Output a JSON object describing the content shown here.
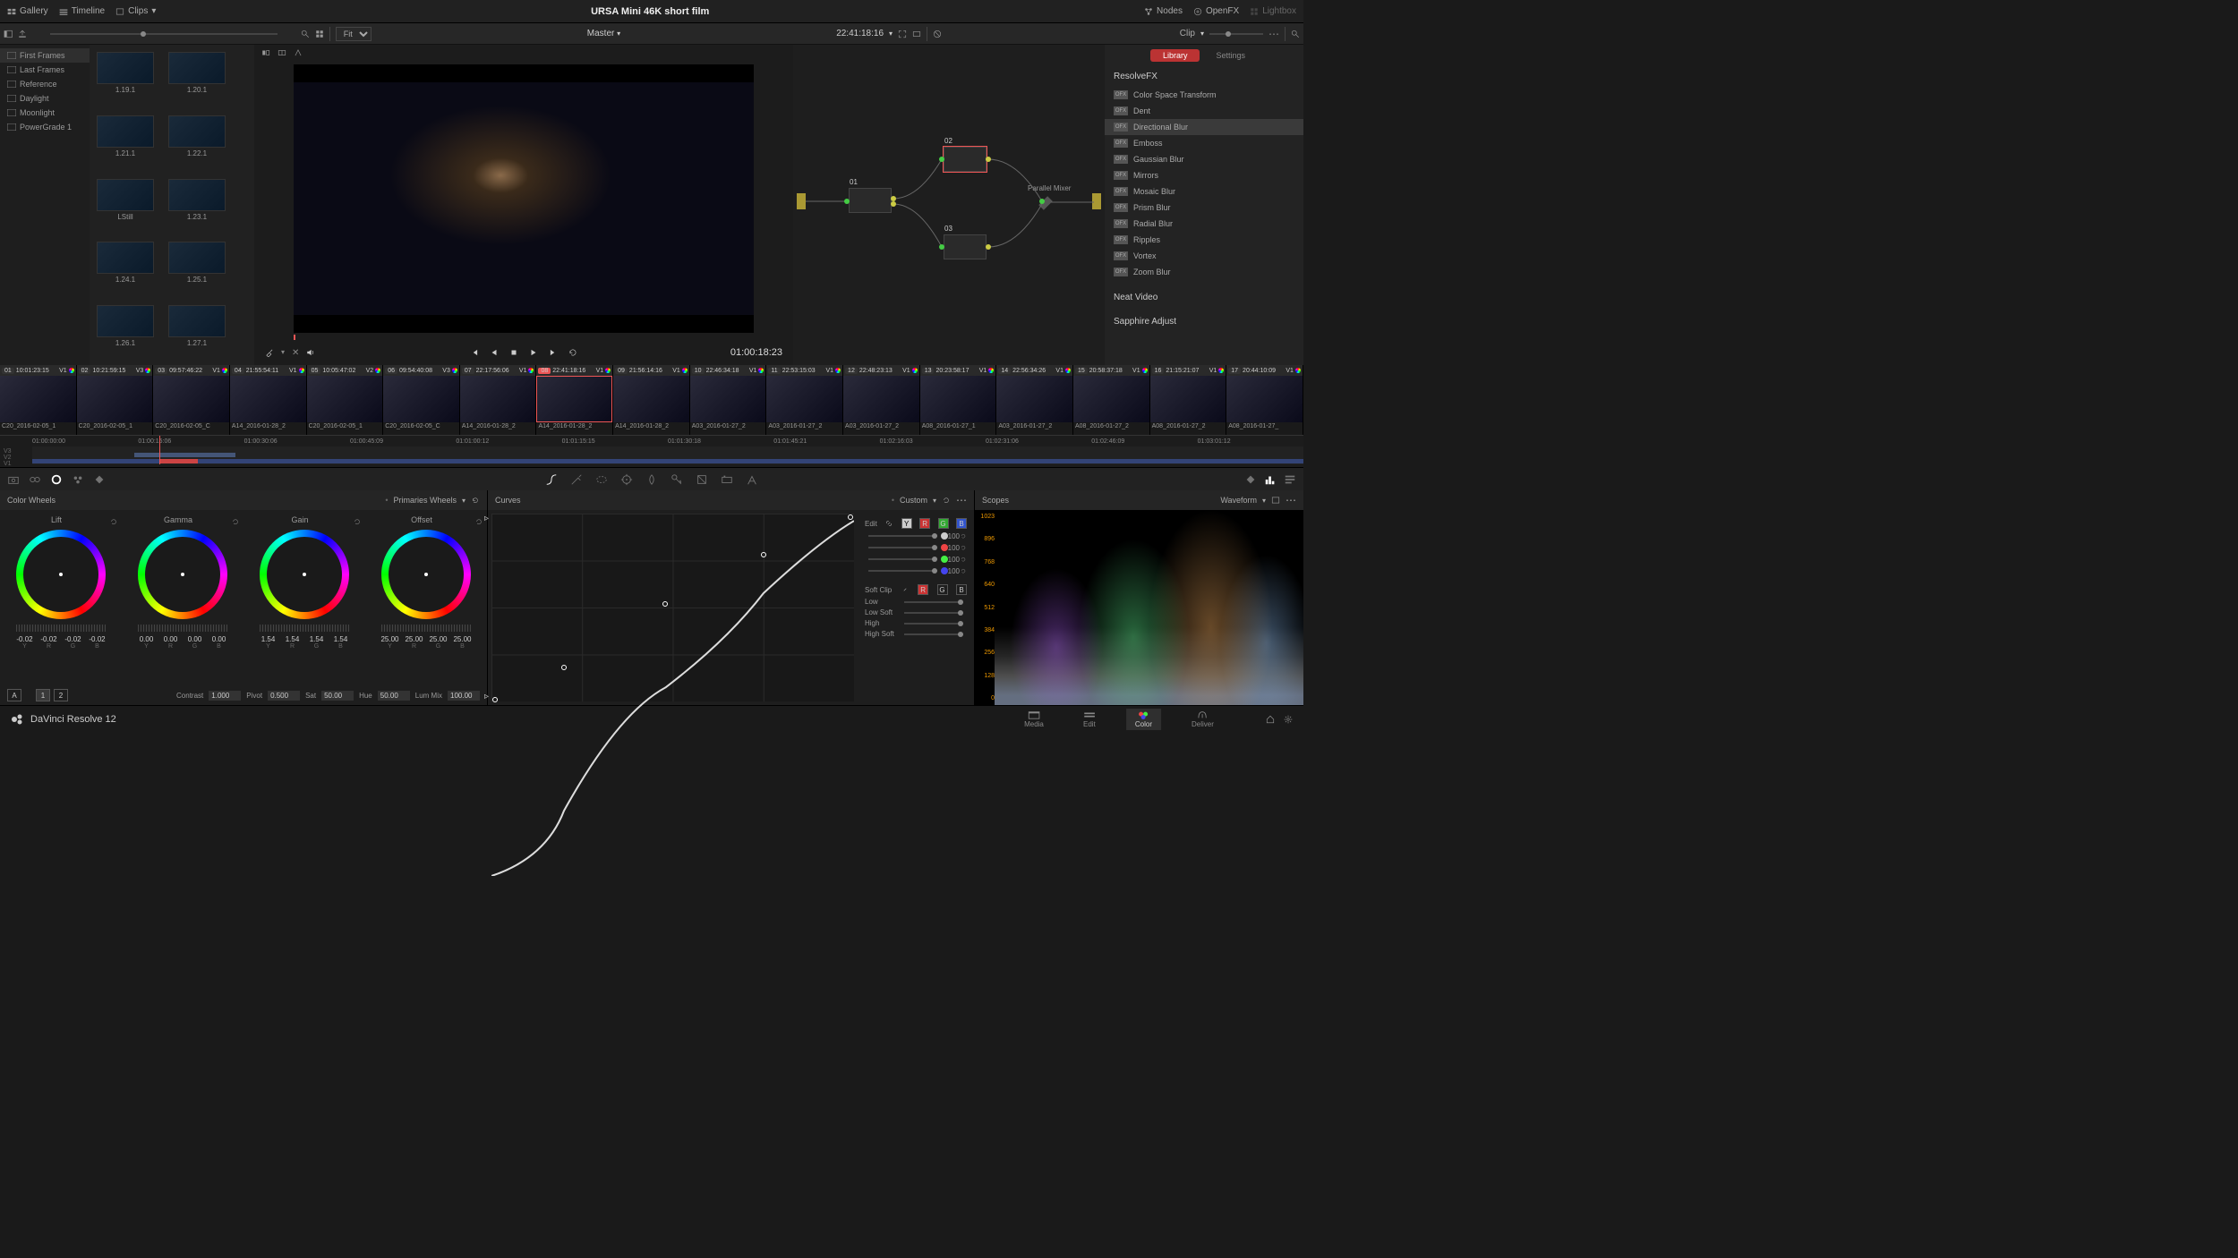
{
  "topbar": {
    "gallery": "Gallery",
    "timeline": "Timeline",
    "clips": "Clips",
    "title": "URSA Mini 46K short film",
    "nodes": "Nodes",
    "openfx": "OpenFX",
    "lightbox": "Lightbox"
  },
  "viewerbar": {
    "fit": "Fit",
    "master": "Master",
    "timecode": "22:41:18:16",
    "clip": "Clip"
  },
  "gallery_folders": [
    "First Frames",
    "Last Frames",
    "Reference",
    "Daylight",
    "Moonlight",
    "PowerGrade 1"
  ],
  "gallery_thumbs": [
    "1.19.1",
    "1.20.1",
    "1.21.1",
    "1.22.1",
    "LStill",
    "1.23.1",
    "1.24.1",
    "1.25.1",
    "1.26.1",
    "1.27.1"
  ],
  "viewer": {
    "tc": "01:00:18:23"
  },
  "nodes": {
    "n01": "01",
    "n02": "02",
    "n03": "03",
    "mixer": "Parallel Mixer"
  },
  "fx": {
    "tab_library": "Library",
    "tab_settings": "Settings",
    "header": "ResolveFX",
    "items": [
      "Color Space Transform",
      "Dent",
      "Directional Blur",
      "Emboss",
      "Gaussian Blur",
      "Mirrors",
      "Mosaic Blur",
      "Prism Blur",
      "Radial Blur",
      "Ripples",
      "Vortex",
      "Zoom Blur"
    ],
    "neat": "Neat Video",
    "sapphire": "Sapphire Adjust"
  },
  "clips": [
    {
      "n": "01",
      "tc": "10:01:23:15",
      "tk": "V1",
      "name": "C20_2016-02-05_1"
    },
    {
      "n": "02",
      "tc": "10:21:59:15",
      "tk": "V3",
      "name": "C20_2016-02-05_1"
    },
    {
      "n": "03",
      "tc": "09:57:46:22",
      "tk": "V1",
      "name": "C20_2016-02-05_C"
    },
    {
      "n": "04",
      "tc": "21:55:54:11",
      "tk": "V1",
      "name": "A14_2016-01-28_2"
    },
    {
      "n": "05",
      "tc": "10:05:47:02",
      "tk": "V2",
      "name": "C20_2016-02-05_1"
    },
    {
      "n": "06",
      "tc": "09:54:40:08",
      "tk": "V3",
      "name": "C20_2016-02-05_C"
    },
    {
      "n": "07",
      "tc": "22:17:56:06",
      "tk": "V1",
      "name": "A14_2016-01-28_2"
    },
    {
      "n": "08",
      "tc": "22:41:18:16",
      "tk": "V1",
      "name": "A14_2016-01-28_2"
    },
    {
      "n": "09",
      "tc": "21:56:14:16",
      "tk": "V1",
      "name": "A14_2016-01-28_2"
    },
    {
      "n": "10",
      "tc": "22:46:34:18",
      "tk": "V1",
      "name": "A03_2016-01-27_2"
    },
    {
      "n": "11",
      "tc": "22:53:15:03",
      "tk": "V1",
      "name": "A03_2016-01-27_2"
    },
    {
      "n": "12",
      "tc": "22:48:23:13",
      "tk": "V1",
      "name": "A03_2016-01-27_2"
    },
    {
      "n": "13",
      "tc": "20:23:58:17",
      "tk": "V1",
      "name": "A08_2016-01-27_1"
    },
    {
      "n": "14",
      "tc": "22:56:34:26",
      "tk": "V1",
      "name": "A03_2016-01-27_2"
    },
    {
      "n": "15",
      "tc": "20:58:37:18",
      "tk": "V1",
      "name": "A08_2016-01-27_2"
    },
    {
      "n": "16",
      "tc": "21:15:21:07",
      "tk": "V1",
      "name": "A08_2016-01-27_2"
    },
    {
      "n": "17",
      "tc": "20:44:10:09",
      "tk": "V1",
      "name": "A08_2016-01-27_"
    }
  ],
  "tl_tracks": [
    "V3",
    "V2",
    "V1"
  ],
  "tl_ticks": [
    "01:00:00:00",
    "01:00:15:06",
    "01:00:30:06",
    "01:00:45:09",
    "01:01:00:12",
    "01:01:15:15",
    "01:01:30:18",
    "01:01:45:21",
    "01:02:16:03",
    "01:02:31:06",
    "01:02:46:09",
    "01:03:01:12"
  ],
  "wheels": {
    "title": "Color Wheels",
    "mode": "Primaries Wheels",
    "cols": [
      {
        "name": "Lift",
        "vals": [
          "-0.02",
          "-0.02",
          "-0.02",
          "-0.02"
        ]
      },
      {
        "name": "Gamma",
        "vals": [
          "0.00",
          "0.00",
          "0.00",
          "0.00"
        ]
      },
      {
        "name": "Gain",
        "vals": [
          "1.54",
          "1.54",
          "1.54",
          "1.54"
        ]
      },
      {
        "name": "Offset",
        "vals": [
          "25.00",
          "25.00",
          "25.00",
          "25.00"
        ]
      }
    ],
    "yrgb": [
      "Y",
      "R",
      "G",
      "B"
    ],
    "contrast_l": "Contrast",
    "contrast": "1.000",
    "pivot_l": "Pivot",
    "pivot": "0.500",
    "sat_l": "Sat",
    "sat": "50.00",
    "hue_l": "Hue",
    "hue": "50.00",
    "lum_l": "Lum Mix",
    "lum": "100.00",
    "a": "A",
    "one": "1",
    "two": "2"
  },
  "curves": {
    "title": "Curves",
    "mode": "Custom",
    "edit": "Edit",
    "val": "100",
    "soft": "Soft Clip",
    "low": "Low",
    "lowsoft": "Low Soft",
    "high": "High",
    "highsoft": "High Soft",
    "y": "Y",
    "r": "R",
    "g": "G",
    "b": "B"
  },
  "scopes": {
    "title": "Scopes",
    "mode": "Waveform",
    "scale": [
      "1023",
      "896",
      "768",
      "640",
      "512",
      "384",
      "256",
      "128",
      "0"
    ]
  },
  "pages": {
    "media": "Media",
    "edit": "Edit",
    "color": "Color",
    "deliver": "Deliver"
  },
  "brand": "DaVinci Resolve 12"
}
